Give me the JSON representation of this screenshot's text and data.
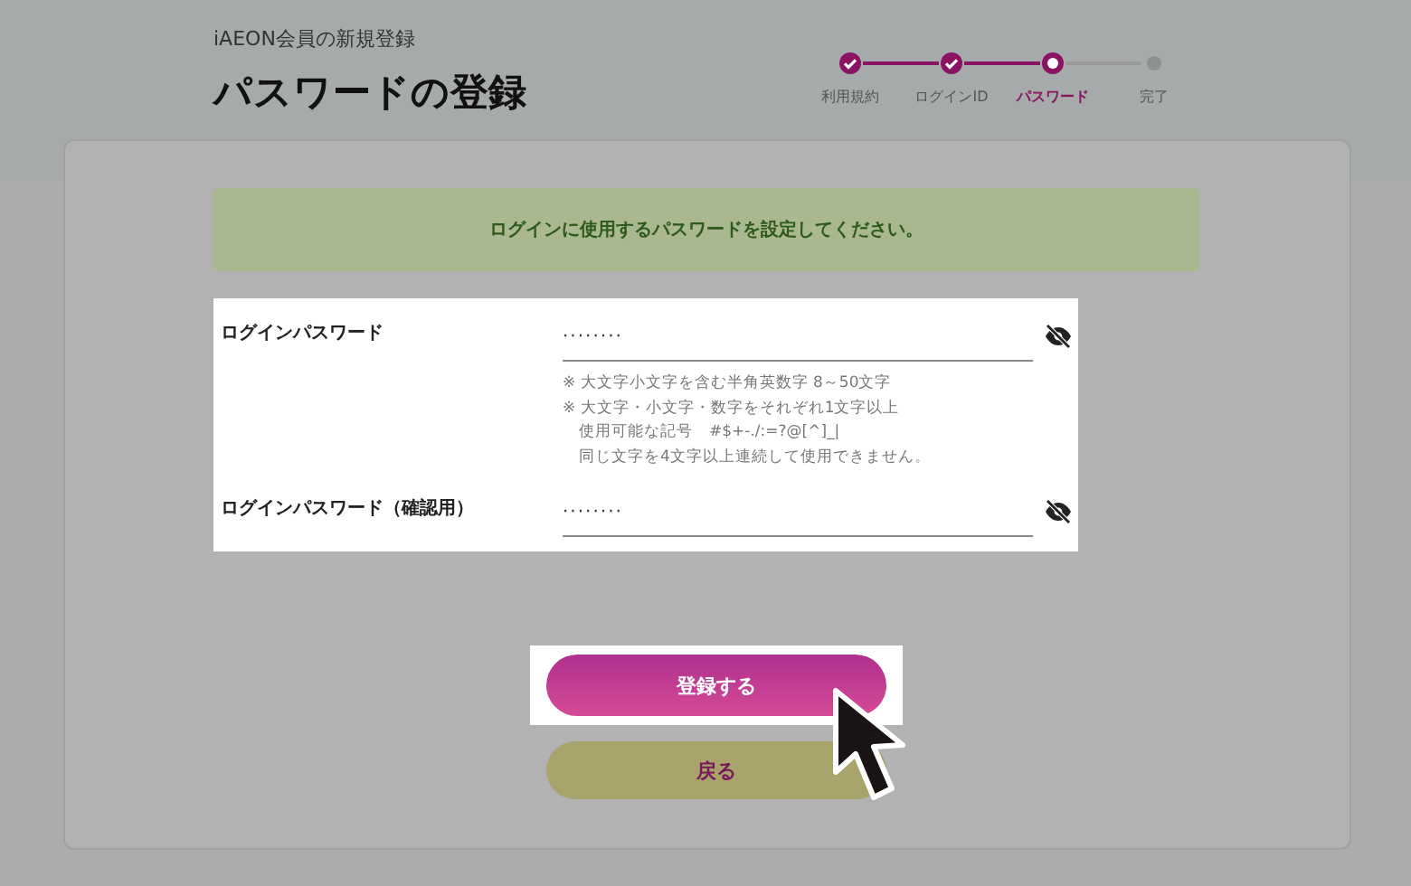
{
  "header": {
    "subtitle": "iAEON会員の新規登録",
    "title": "パスワードの登録"
  },
  "steps": [
    {
      "label": "利用規約",
      "kind": "done"
    },
    {
      "label": "ログインID",
      "kind": "done"
    },
    {
      "label": "パスワード",
      "kind": "current"
    },
    {
      "label": "完了",
      "kind": "todo"
    }
  ],
  "notice": "ログインに使用するパスワードを設定してください。",
  "fields": [
    {
      "label": "ログインパスワード",
      "value": "········",
      "notes": [
        "※ 大文字小文字を含む半角英数字 8～50文字",
        "※ 大文字・小文字・数字をそれぞれ1文字以上",
        "　使用可能な記号　#$+-./:=?@[^]_|",
        "　同じ文字を4文字以上連続して使用できません。"
      ]
    },
    {
      "label": "ログインパスワード（確認用）",
      "value": "········"
    }
  ],
  "buttons": [
    {
      "label": "登録する",
      "kind": "primary"
    },
    {
      "label": "戻る",
      "kind": "secondary"
    }
  ]
}
